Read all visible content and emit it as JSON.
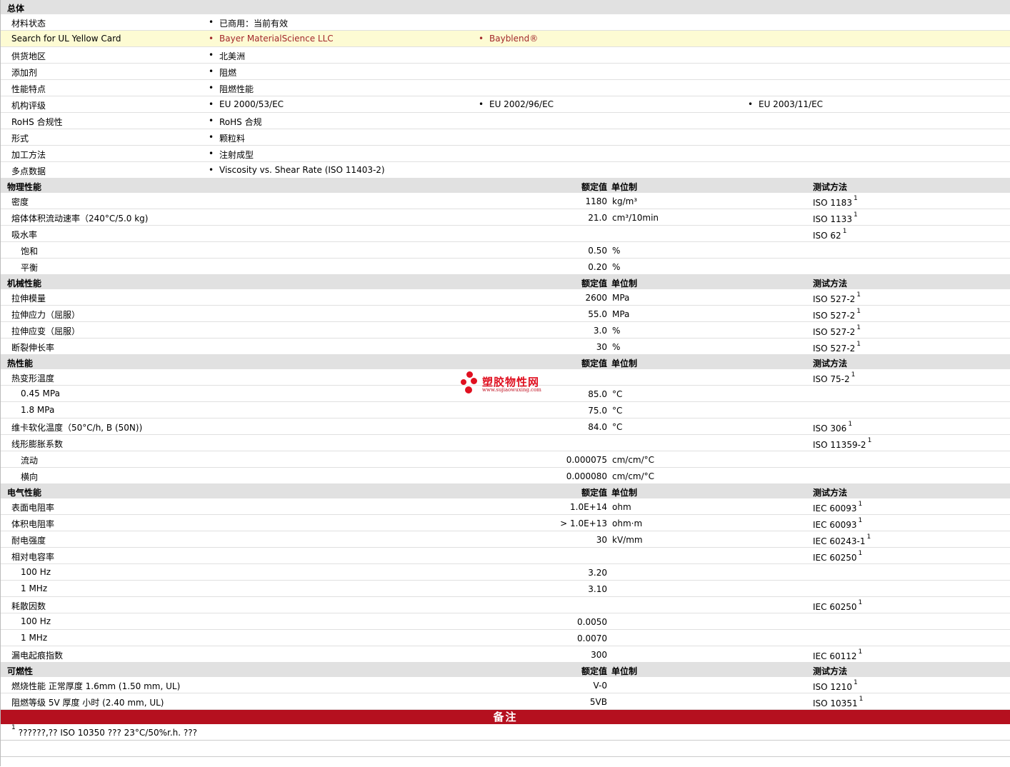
{
  "general": {
    "title": "总体",
    "rows": [
      {
        "name": "材料状态",
        "cols": [
          "已商用：当前有效"
        ]
      },
      {
        "name": "Search for UL Yellow Card",
        "cols": [
          "Bayer MaterialScience LLC",
          "Bayblend®"
        ],
        "highlight": true
      },
      {
        "name": "供货地区",
        "cols": [
          "北美洲"
        ]
      },
      {
        "name": "添加剂",
        "cols": [
          "阻燃"
        ]
      },
      {
        "name": "性能特点",
        "cols": [
          "阻燃性能"
        ]
      },
      {
        "name": "机构评级",
        "cols": [
          "EU 2000/53/EC",
          "EU 2002/96/EC",
          "EU 2003/11/EC"
        ]
      },
      {
        "name": "RoHS 合规性",
        "cols": [
          "RoHS 合规"
        ]
      },
      {
        "name": "形式",
        "cols": [
          "颗粒料"
        ]
      },
      {
        "name": "加工方法",
        "cols": [
          "注射成型"
        ]
      },
      {
        "name": "多点数据",
        "cols": [
          "Viscosity vs. Shear Rate (ISO 11403-2)"
        ]
      }
    ]
  },
  "headers": {
    "rated": "额定值",
    "unit": "单位制",
    "method": "测试方法"
  },
  "sections": [
    {
      "title": "物理性能",
      "rows": [
        {
          "name": "密度",
          "value": "1180",
          "unit": "kg/m³",
          "method": "ISO 1183",
          "sup": "1"
        },
        {
          "name": "熔体体积流动速率（240°C/5.0 kg)",
          "value": "21.0",
          "unit": "cm³/10min",
          "method": "ISO 1133",
          "sup": "1"
        },
        {
          "name": "吸水率",
          "value": "",
          "unit": "",
          "method": "ISO 62",
          "sup": "1"
        },
        {
          "name": "饱和",
          "value": "0.50",
          "unit": "%",
          "method": "",
          "sub": true
        },
        {
          "name": "平衡",
          "value": "0.20",
          "unit": "%",
          "method": "",
          "sub": true
        }
      ]
    },
    {
      "title": "机械性能",
      "rows": [
        {
          "name": "拉伸模量",
          "value": "2600",
          "unit": "MPa",
          "method": "ISO 527-2",
          "sup": "1"
        },
        {
          "name": "拉伸应力（屈服）",
          "value": "55.0",
          "unit": "MPa",
          "method": "ISO 527-2",
          "sup": "1"
        },
        {
          "name": "拉伸应变（屈服）",
          "value": "3.0",
          "unit": "%",
          "method": "ISO 527-2",
          "sup": "1"
        },
        {
          "name": "断裂伸长率",
          "value": "30",
          "unit": "%",
          "method": "ISO 527-2",
          "sup": "1"
        }
      ]
    },
    {
      "title": "热性能",
      "rows": [
        {
          "name": "热变形温度",
          "value": "",
          "unit": "",
          "method": "ISO 75-2",
          "sup": "1"
        },
        {
          "name": "0.45 MPa",
          "value": "85.0",
          "unit": "°C",
          "method": "",
          "sub": true
        },
        {
          "name": "1.8 MPa",
          "value": "75.0",
          "unit": "°C",
          "method": "",
          "sub": true
        },
        {
          "name": "维卡软化温度（50°C/h, B (50N))",
          "value": "84.0",
          "unit": "°C",
          "method": "ISO 306",
          "sup": "1"
        },
        {
          "name": "线形膨胀系数",
          "value": "",
          "unit": "",
          "method": "ISO 11359-2",
          "sup": "1"
        },
        {
          "name": "流动",
          "value": "0.000075",
          "unit": "cm/cm/°C",
          "method": "",
          "sub": true
        },
        {
          "name": "横向",
          "value": "0.000080",
          "unit": "cm/cm/°C",
          "method": "",
          "sub": true
        }
      ]
    },
    {
      "title": "电气性能",
      "rows": [
        {
          "name": "表面电阻率",
          "value": "1.0E+14",
          "unit": "ohm",
          "method": "IEC 60093",
          "sup": "1"
        },
        {
          "name": "体积电阻率",
          "value": "> 1.0E+13",
          "unit": "ohm·m",
          "method": "IEC 60093",
          "sup": "1"
        },
        {
          "name": "耐电强度",
          "value": "30",
          "unit": "kV/mm",
          "method": "IEC 60243-1",
          "sup": "1"
        },
        {
          "name": "相对电容率",
          "value": "",
          "unit": "",
          "method": "IEC 60250",
          "sup": "1"
        },
        {
          "name": "100 Hz",
          "value": "3.20",
          "unit": "",
          "method": "",
          "sub": true
        },
        {
          "name": "1 MHz",
          "value": "3.10",
          "unit": "",
          "method": "",
          "sub": true
        },
        {
          "name": "耗散因数",
          "value": "",
          "unit": "",
          "method": "IEC 60250",
          "sup": "1"
        },
        {
          "name": "100 Hz",
          "value": "0.0050",
          "unit": "",
          "method": "",
          "sub": true
        },
        {
          "name": "1 MHz",
          "value": "0.0070",
          "unit": "",
          "method": "",
          "sub": true
        },
        {
          "name": "漏电起痕指数",
          "value": "300",
          "unit": "",
          "method": "IEC 60112",
          "sup": "1"
        }
      ]
    },
    {
      "title": "可燃性",
      "rows": [
        {
          "name": "燃烧性能  正常厚度  1.6mm (1.50 mm, UL)",
          "value": "V-0",
          "unit": "",
          "method": "ISO 1210",
          "sup": "1"
        },
        {
          "name": "阻燃等级  5V 厚度  小时  (2.40 mm, UL)",
          "value": "5VB",
          "unit": "",
          "method": "ISO 10351",
          "sup": "1"
        }
      ]
    }
  ],
  "notes": {
    "title": "备注",
    "items": [
      {
        "sup": "1",
        "text": "??????,?? ISO 10350 ??? 23°C/50%r.h. ???"
      }
    ]
  },
  "watermark": {
    "cn": "塑胶物性网",
    "url": "www.sujiaowuxing.com"
  },
  "colors": {
    "notes_bar": "#b5101f",
    "highlight_row": "#fdfbd3",
    "section_bg": "#e1e1e1",
    "link": "#a3282b"
  }
}
